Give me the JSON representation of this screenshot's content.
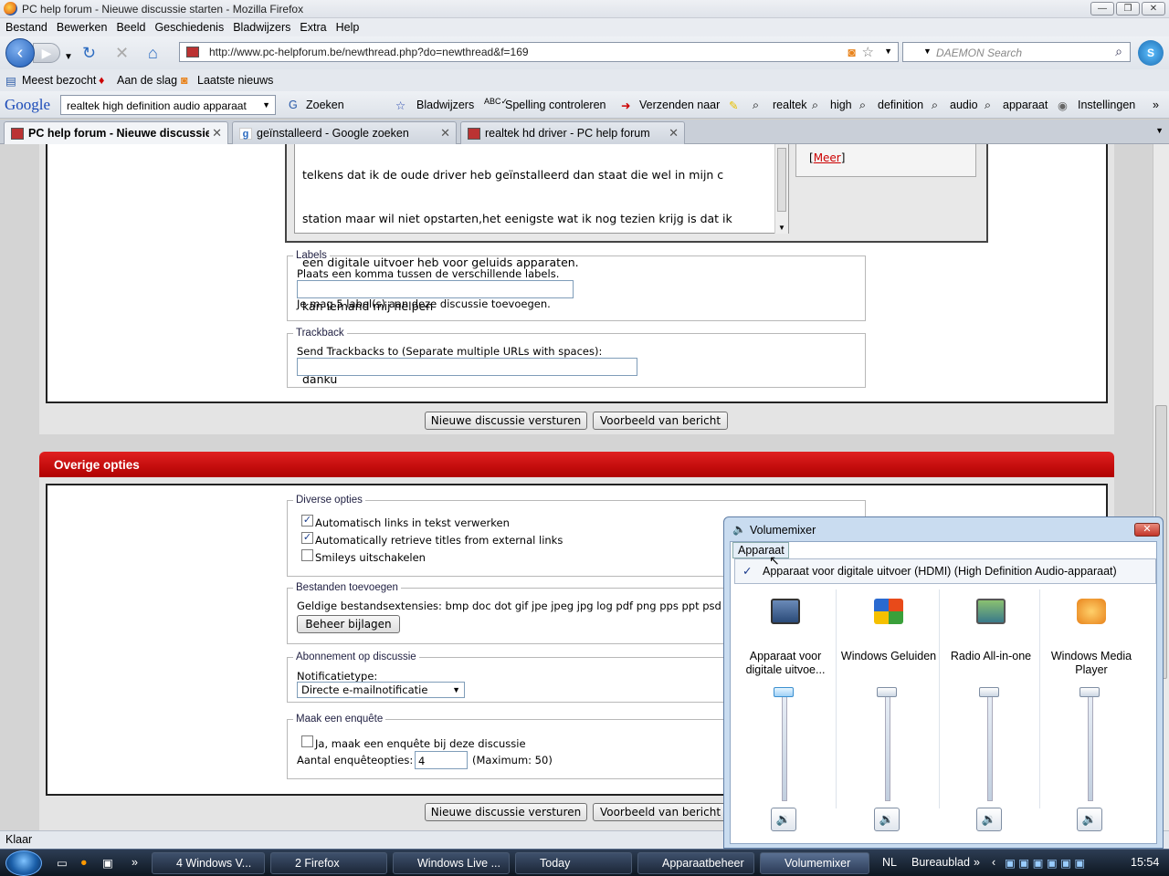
{
  "window": {
    "title": "PC help forum - Nieuwe discussie starten - Mozilla Firefox",
    "min": "▭",
    "max": "▭",
    "close": "✕"
  },
  "menu": [
    "Bestand",
    "Bewerken",
    "Beeld",
    "Geschiedenis",
    "Bladwijzers",
    "Extra",
    "Help"
  ],
  "nav": {
    "url": "http://www.pc-helpforum.be/newthread.php?do=newthread&f=169",
    "search_placeholder": "DAEMON Search"
  },
  "bookmarks": [
    "Meest bezocht",
    "Aan de slag",
    "Laatste nieuws"
  ],
  "google_toolbar": {
    "logo": "Google",
    "query": "realtek high definition audio apparaat",
    "items": [
      "Zoeken",
      "Bladwijzers",
      "Spelling controleren",
      "Verzenden naar",
      "realtek",
      "high",
      "definition",
      "audio",
      "apparaat",
      "Instellingen"
    ]
  },
  "tabs": [
    {
      "label": "PC help forum - Nieuwe discussie ..."
    },
    {
      "label": "geïnstalleerd - Google zoeken"
    },
    {
      "label": "realtek hd driver - PC help forum"
    }
  ],
  "editor": {
    "lines": [
      "telkens dat ik de oude driver heb geïnstalleerd dan staat die wel in mijn c",
      "station maar wil niet opstarten,het eenigste wat ik nog tezien krijg is dat ik",
      "een digitale uitvoer heb voor geluids apparaten.",
      "kan iemand mij helpen",
      "",
      "danku"
    ],
    "more_link": "Meer"
  },
  "labels": {
    "legend": "Labels",
    "hint": "Plaats een komma tussen de verschillende labels.",
    "note": "Je mag 5 label(s) aan deze discussie toevoegen."
  },
  "trackback": {
    "legend": "Trackback",
    "hint": "Send Trackbacks to (Separate multiple URLs with spaces):"
  },
  "buttons": {
    "submit": "Nieuwe discussie versturen",
    "preview": "Voorbeeld van bericht"
  },
  "overige": {
    "header": "Overige opties"
  },
  "diverse": {
    "legend": "Diverse opties",
    "options": [
      "Automatisch links in tekst verwerken",
      "Automatically retrieve titles from external links",
      "Smileys uitschakelen"
    ]
  },
  "bestanden": {
    "legend": "Bestanden toevoegen",
    "ext": "Geldige bestandsextensies: bmp doc dot gif jpe jpeg jpg log pdf png pps ppt psd",
    "button": "Beheer bijlagen"
  },
  "abonnement": {
    "legend": "Abonnement op discussie",
    "label": "Notificatietype:",
    "value": "Directe e-mailnotificatie"
  },
  "enquete": {
    "legend": "Maak een enquête",
    "check": "Ja, maak een enquête bij deze discussie",
    "label": "Aantal enquêteopties:",
    "value": "4",
    "max": "(Maximum: 50)"
  },
  "status": "Klaar",
  "taskbar": {
    "items": [
      "4 Windows V...",
      "2 Firefox",
      "Windows Live ...",
      "Today",
      "Apparaatbeheer",
      "Volumemixer"
    ],
    "lang": "NL",
    "desktop": "Bureaublad",
    "clock": "15:54"
  },
  "mixer": {
    "title": "Volumemixer",
    "menu": "Apparaat",
    "device": "Apparaat voor digitale uitvoer (HDMI) (High Definition Audio-apparaat)",
    "channels": [
      {
        "name": "Apparaat voor digitale uitvoe...",
        "icon": "monitor-icon",
        "color": "#3a5f8f"
      },
      {
        "name": "Windows Geluiden",
        "icon": "windows-icon",
        "color": "#e07a20"
      },
      {
        "name": "Radio All-in-one",
        "icon": "radio-icon",
        "color": "#4a8a3a"
      },
      {
        "name": "Windows Media Player",
        "icon": "media-player-icon",
        "color": "#e8831c"
      }
    ]
  }
}
